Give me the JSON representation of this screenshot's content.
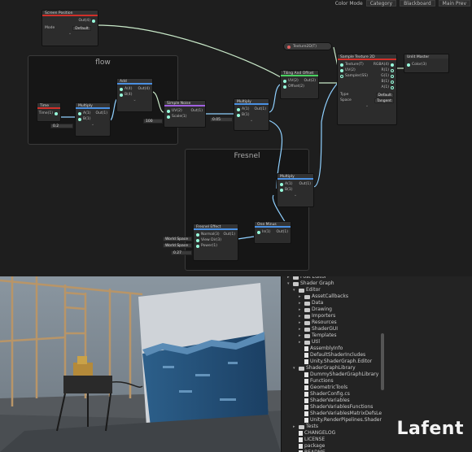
{
  "topbar": {
    "color_label": "Color Mode",
    "color_value": "Category",
    "blackboard": "Blackboard",
    "main_preview": "Main Prev"
  },
  "groups": {
    "flow": "flow",
    "fresnel": "Fresnel"
  },
  "nodes": {
    "screen_position": {
      "title": "Screen Position",
      "out": "Out(4)",
      "mode_label": "Mode",
      "mode_value": "Default"
    },
    "time": {
      "title": "Time",
      "out": "Time(1)"
    },
    "multiply1": {
      "title": "Multiply",
      "a": "A(1)",
      "b": "B(1)",
      "out": "Out(1)",
      "b_value": "0.2"
    },
    "add": {
      "title": "Add",
      "a": "A(4)",
      "b": "B(4)",
      "out": "Out(4)"
    },
    "simple_noise": {
      "title": "Simple Noise",
      "uv": "UV(2)",
      "scale": "Scale(1)",
      "out": "Out(1)",
      "scale_value": "100"
    },
    "multiply2": {
      "title": "Multiply",
      "a": "A(1)",
      "b": "B(1)",
      "out": "Out(1)",
      "b_value": "0.05"
    },
    "tiling_offset": {
      "title": "Tiling And Offset",
      "uv": "UV(2)",
      "offset": "Offset(2)",
      "out": "Out(2)"
    },
    "texture_prop": {
      "title": "Texture2D(T)"
    },
    "sample_texture": {
      "title": "Sample Texture 2D",
      "texture": "Texture(T)",
      "uv": "UV(2)",
      "sampler": "Sampler(SS)",
      "rgba": "RGBA(4)",
      "r": "R(1)",
      "g": "G(1)",
      "b": "B(1)",
      "a": "A(1)",
      "type_label": "Type",
      "type_value": "Default",
      "space_label": "Space",
      "space_value": "Tangent"
    },
    "unlit_master": {
      "title": "Unlit Master",
      "color": "Color(3)"
    },
    "multiply3": {
      "title": "Multiply",
      "a": "A(1)",
      "b": "B(1)",
      "out": "Out(1)"
    },
    "fresnel": {
      "title": "Fresnel Effect",
      "normal": "Normal(3)",
      "view": "View Dir(3)",
      "power": "Power(1)",
      "out": "Out(1)",
      "normal_space": "World Space",
      "view_space": "World Space",
      "power_value": "0.27"
    },
    "one_minus": {
      "title": "One Minus",
      "in": "In(1)",
      "out": "Out(1)"
    }
  },
  "project": {
    "items": [
      {
        "label": "Post Editor",
        "depth": 1,
        "type": "folder"
      },
      {
        "label": "Shader Graph",
        "depth": 1,
        "type": "folder",
        "open": true
      },
      {
        "label": "Editor",
        "depth": 2,
        "type": "folder",
        "open": true
      },
      {
        "label": "AssetCallbacks",
        "depth": 3,
        "type": "folder"
      },
      {
        "label": "Data",
        "depth": 3,
        "type": "folder"
      },
      {
        "label": "Drawing",
        "depth": 3,
        "type": "folder"
      },
      {
        "label": "Importers",
        "depth": 3,
        "type": "folder"
      },
      {
        "label": "Resources",
        "depth": 3,
        "type": "folder"
      },
      {
        "label": "ShaderGUI",
        "depth": 3,
        "type": "folder"
      },
      {
        "label": "Templates",
        "depth": 3,
        "type": "folder"
      },
      {
        "label": "Util",
        "depth": 3,
        "type": "folder"
      },
      {
        "label": "AssemblyInfo",
        "depth": 3,
        "type": "file"
      },
      {
        "label": "DefaultShaderIncludes",
        "depth": 3,
        "type": "file"
      },
      {
        "label": "Unity.ShaderGraph.Editor",
        "depth": 3,
        "type": "file"
      },
      {
        "label": "ShaderGraphLibrary",
        "depth": 2,
        "type": "folder",
        "open": true
      },
      {
        "label": "DummyShaderGraphLibrary",
        "depth": 3,
        "type": "file"
      },
      {
        "label": "Functions",
        "depth": 3,
        "type": "file"
      },
      {
        "label": "GeometricTools",
        "depth": 3,
        "type": "file"
      },
      {
        "label": "ShaderConfig.cs",
        "depth": 3,
        "type": "file"
      },
      {
        "label": "ShaderVariables",
        "depth": 3,
        "type": "file"
      },
      {
        "label": "ShaderVariablesFunctions",
        "depth": 3,
        "type": "file"
      },
      {
        "label": "ShaderVariablesMatrixDefsLe",
        "depth": 3,
        "type": "file"
      },
      {
        "label": "Unity.RenderPipelines.Shader",
        "depth": 3,
        "type": "file"
      },
      {
        "label": "Tests",
        "depth": 2,
        "type": "folder"
      },
      {
        "label": "CHANGELOG",
        "depth": 2,
        "type": "file"
      },
      {
        "label": "LICENSE",
        "depth": 2,
        "type": "file"
      },
      {
        "label": "package",
        "depth": 2,
        "type": "file"
      },
      {
        "label": "README",
        "depth": 2,
        "type": "file"
      }
    ]
  },
  "logo": "Lafent"
}
